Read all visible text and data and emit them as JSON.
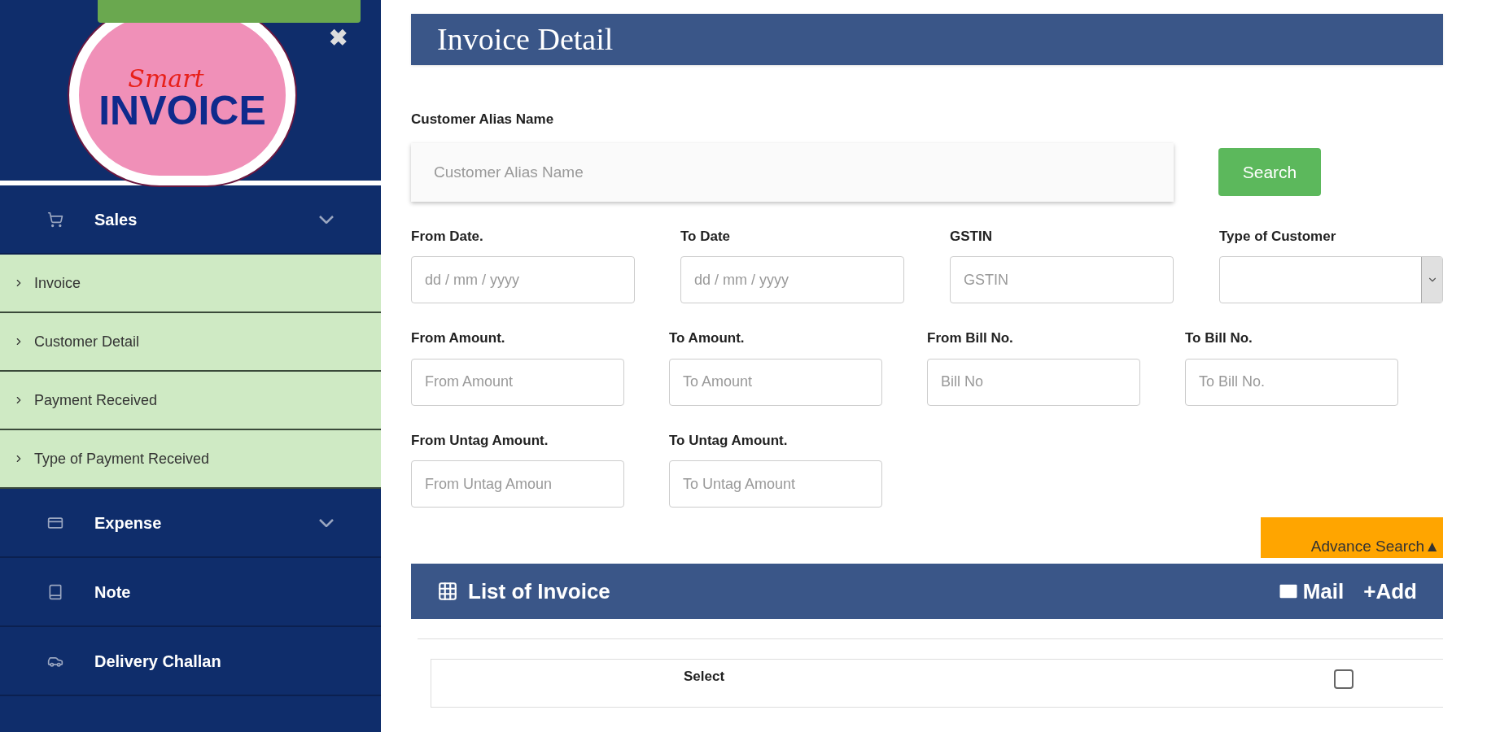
{
  "sidebar": {
    "logo": {
      "script": "Smart",
      "word": "INVOICE"
    },
    "close": "✖",
    "items": [
      {
        "label": "Sales",
        "expandable": true,
        "children": [
          {
            "label": "Invoice"
          },
          {
            "label": "Customer Detail"
          },
          {
            "label": "Payment Received"
          },
          {
            "label": "Type of Payment Received"
          }
        ]
      },
      {
        "label": "Expense",
        "expandable": true
      },
      {
        "label": "Note",
        "expandable": false
      },
      {
        "label": "Delivery Challan",
        "expandable": false
      }
    ]
  },
  "header": {
    "title": "Invoice Detail"
  },
  "search": {
    "label": "Customer Alias Name",
    "placeholder": "Customer Alias Name",
    "button": "Search"
  },
  "filter_rows": [
    [
      {
        "label": "From Date.",
        "kind": "text",
        "placeholder": "dd / mm / yyyy"
      },
      {
        "label": "To Date",
        "kind": "text",
        "placeholder": "dd / mm / yyyy"
      },
      {
        "label": "GSTIN",
        "kind": "text",
        "placeholder": "GSTIN"
      },
      {
        "label": "Type of Customer",
        "kind": "select"
      }
    ],
    [
      {
        "label": "From Amount.",
        "kind": "text",
        "placeholder": "From Amount"
      },
      {
        "label": "To Amount.",
        "kind": "text",
        "placeholder": "To Amount"
      },
      {
        "label": "From Bill No.",
        "kind": "text",
        "placeholder": "Bill No"
      },
      {
        "label": "To Bill No.",
        "kind": "text",
        "placeholder": "To Bill No."
      }
    ],
    [
      {
        "label": "From Untag Amount.",
        "kind": "text",
        "placeholder": "From Untag Amoun"
      },
      {
        "label": "To Untag Amount.",
        "kind": "text",
        "placeholder": "To Untag Amount"
      }
    ]
  ],
  "advance_search": {
    "label": "Advance Search",
    "arrow": "▲"
  },
  "list": {
    "title": "List of Invoice",
    "mail": "Mail",
    "add": "+Add"
  },
  "table": {
    "columns": [
      {
        "label": "Select"
      }
    ],
    "select_all": {
      "checked": false
    }
  }
}
